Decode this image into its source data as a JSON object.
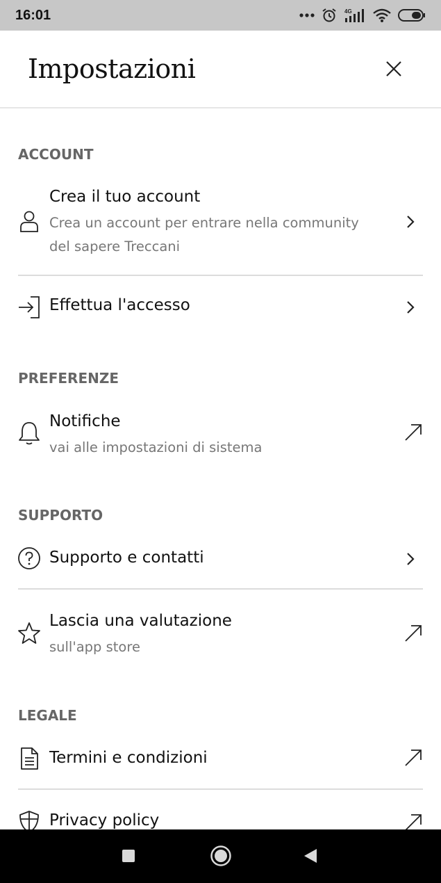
{
  "status_bar": {
    "time": "16:01",
    "network_label": "4G",
    "icons": [
      "more-dots-icon",
      "alarm-icon",
      "signal-4g-icon",
      "wifi-icon",
      "battery-icon"
    ]
  },
  "header": {
    "title": "Impostazioni",
    "close_icon": "close-icon"
  },
  "sections": {
    "account": {
      "heading": "ACCOUNT",
      "create": {
        "label": "Crea il tuo account",
        "sub_line1": "Crea un account per entrare nella community",
        "sub_line2": "del sapere Treccani"
      },
      "login": {
        "label": "Effettua l'accesso"
      }
    },
    "preferenze": {
      "heading": "PREFERENZE",
      "notifiche": {
        "label": "Notifiche",
        "sub": "vai alle impostazioni di sistema"
      }
    },
    "supporto": {
      "heading": "SUPPORTO",
      "contatti": {
        "label": "Supporto e contatti"
      },
      "valutazione": {
        "label": "Lascia una valutazione",
        "sub": "sull'app store"
      }
    },
    "legale": {
      "heading": "LEGALE",
      "termini": {
        "label": "Termini e condizioni"
      },
      "privacy": {
        "label": "Privacy policy"
      }
    }
  },
  "nav_bar": {
    "buttons": [
      "recents-square-icon",
      "home-circle-icon",
      "back-triangle-icon"
    ]
  },
  "colors": {
    "status_bar_bg": "#c7c7c7",
    "section_heading": "#666666",
    "subtitle": "#777777",
    "divider": "#dcdcdc",
    "nav_bar_bg": "#000000"
  }
}
